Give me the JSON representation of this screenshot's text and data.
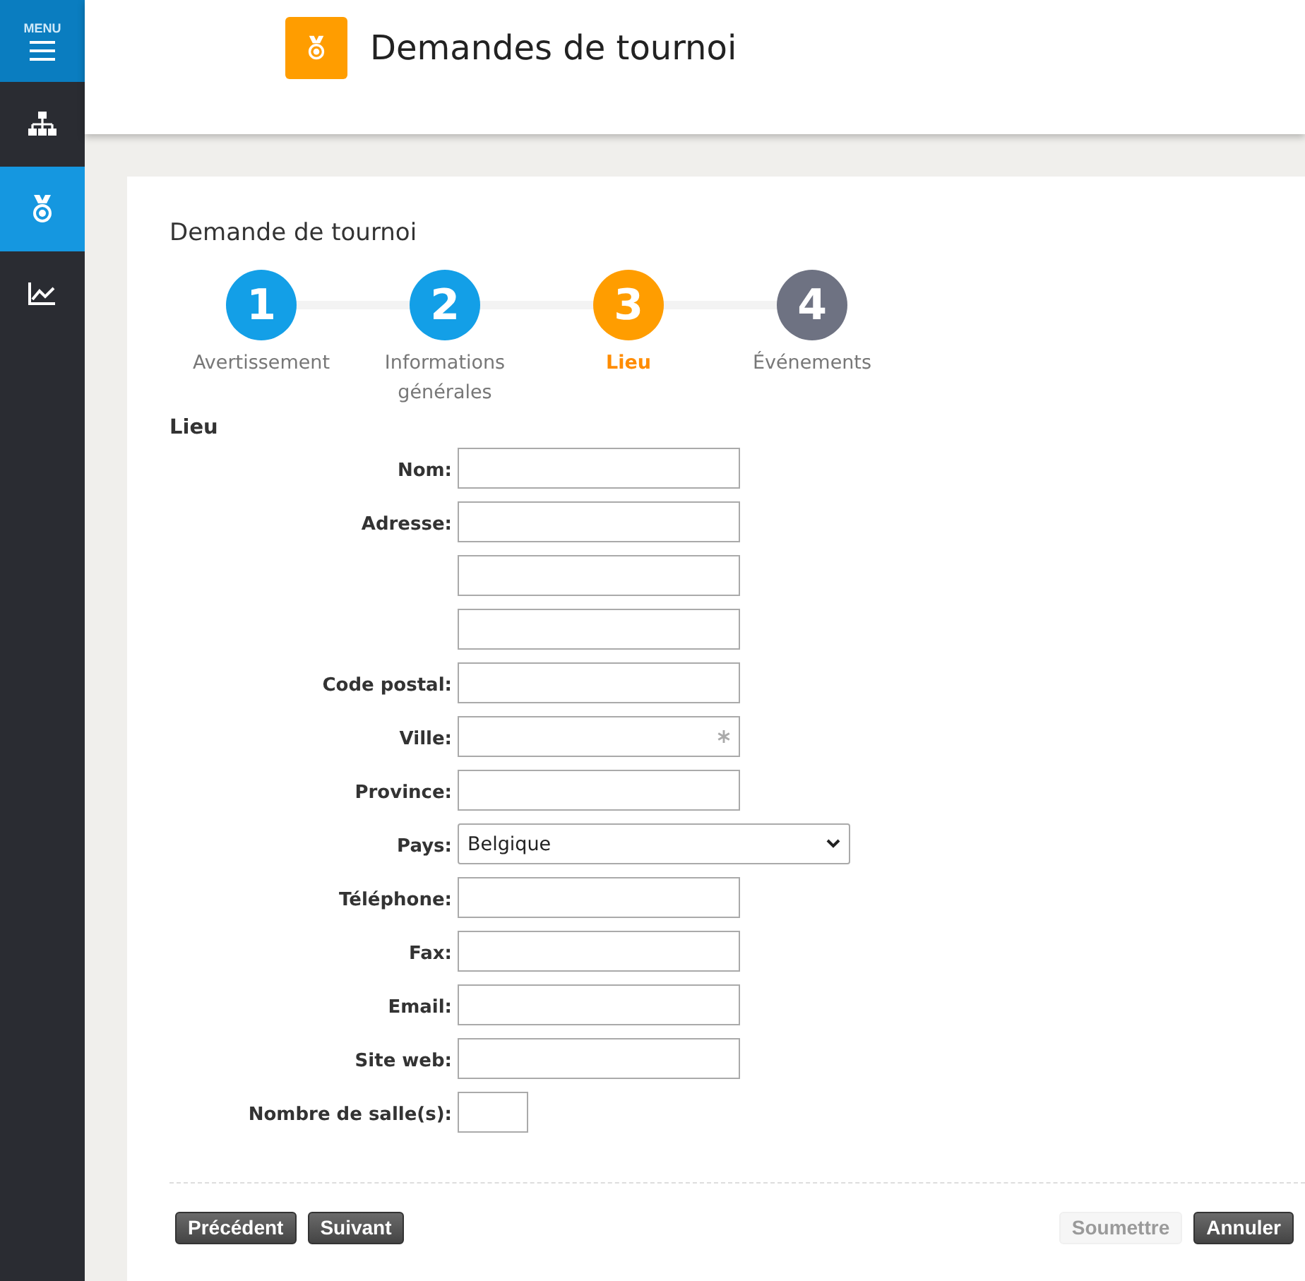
{
  "sidebar": {
    "menu_label": "MENU",
    "items": [
      {
        "kind": "hierarchy",
        "selected": false
      },
      {
        "kind": "medal",
        "selected": true
      },
      {
        "kind": "chart",
        "selected": false
      }
    ]
  },
  "header": {
    "title": "Demandes de tournoi"
  },
  "form": {
    "title": "Demande de tournoi",
    "steps": [
      {
        "number": "1",
        "label": "Avertissement",
        "completed": true,
        "selected": false
      },
      {
        "number": "2",
        "label": "Informations générales",
        "completed": true,
        "selected": false
      },
      {
        "number": "3",
        "label": "Lieu",
        "completed": false,
        "selected": true
      },
      {
        "number": "4",
        "label": "Événements",
        "completed": false,
        "selected": false
      }
    ],
    "section": "Lieu",
    "fields": [
      {
        "label": "Nom:",
        "kind": "text"
      },
      {
        "label": "Adresse:",
        "kind": "text"
      },
      {
        "kind": "text"
      },
      {
        "kind": "text"
      },
      {
        "label": "Code postal:",
        "kind": "text"
      },
      {
        "label": "Ville:",
        "kind": "text",
        "required": true
      },
      {
        "label": "Province:",
        "kind": "text"
      },
      {
        "label": "Pays:",
        "kind": "select",
        "value": "Belgique"
      },
      {
        "label": "Téléphone:",
        "kind": "text"
      },
      {
        "label": "Fax:",
        "kind": "text"
      },
      {
        "label": "Email:",
        "kind": "text"
      },
      {
        "label": "Site web:",
        "kind": "text"
      },
      {
        "label": "Nombre de salle(s):",
        "kind": "short"
      }
    ],
    "buttons_left": [
      {
        "label": "Précédent",
        "disabled": false
      },
      {
        "label": "Suivant",
        "disabled": false
      }
    ],
    "buttons_right": [
      {
        "label": "Soumettre",
        "disabled": true
      },
      {
        "label": "Annuler",
        "disabled": false
      }
    ]
  }
}
